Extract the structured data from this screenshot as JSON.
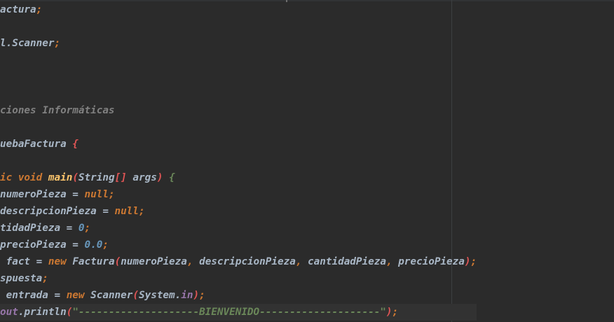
{
  "editor": {
    "lines": [
      {
        "segments": [
          {
            "t": "actura",
            "c": "plain"
          },
          {
            "t": ";",
            "c": "semi"
          }
        ]
      },
      {
        "segments": []
      },
      {
        "segments": [
          {
            "t": "l.Scanner",
            "c": "plain"
          },
          {
            "t": ";",
            "c": "semi"
          }
        ]
      },
      {
        "segments": []
      },
      {
        "segments": []
      },
      {
        "segments": []
      },
      {
        "segments": [
          {
            "t": "ciones Informáticas",
            "c": "cmt"
          }
        ]
      },
      {
        "segments": []
      },
      {
        "segments": [
          {
            "t": "uebaFactura ",
            "c": "plain"
          },
          {
            "t": "{",
            "c": "br-red"
          }
        ]
      },
      {
        "segments": []
      },
      {
        "segments": [
          {
            "t": "ic void ",
            "c": "kw"
          },
          {
            "t": "main",
            "c": "fn"
          },
          {
            "t": "(",
            "c": "br-red"
          },
          {
            "t": "String",
            "c": "plain"
          },
          {
            "t": "[]",
            "c": "br-red"
          },
          {
            "t": " args",
            "c": "plain"
          },
          {
            "t": ")",
            "c": "br-red"
          },
          {
            "t": " ",
            "c": "plain"
          },
          {
            "t": "{",
            "c": "br-green"
          }
        ]
      },
      {
        "segments": [
          {
            "t": "numeroPieza = ",
            "c": "plain"
          },
          {
            "t": "null",
            "c": "kw"
          },
          {
            "t": ";",
            "c": "semi"
          }
        ]
      },
      {
        "segments": [
          {
            "t": "descripcionPieza = ",
            "c": "plain"
          },
          {
            "t": "null",
            "c": "kw"
          },
          {
            "t": ";",
            "c": "semi"
          }
        ]
      },
      {
        "segments": [
          {
            "t": "tidadPieza = ",
            "c": "plain"
          },
          {
            "t": "0",
            "c": "num"
          },
          {
            "t": ";",
            "c": "semi"
          }
        ]
      },
      {
        "segments": [
          {
            "t": "precioPieza = ",
            "c": "plain"
          },
          {
            "t": "0.0",
            "c": "num"
          },
          {
            "t": ";",
            "c": "semi"
          }
        ]
      },
      {
        "segments": [
          {
            "t": " fact = ",
            "c": "plain"
          },
          {
            "t": "new ",
            "c": "kw"
          },
          {
            "t": "Factura",
            "c": "plain"
          },
          {
            "t": "(",
            "c": "br-red"
          },
          {
            "t": "numeroPieza",
            "c": "plain"
          },
          {
            "t": ", ",
            "c": "semi"
          },
          {
            "t": "descripcionPieza",
            "c": "plain"
          },
          {
            "t": ", ",
            "c": "semi"
          },
          {
            "t": "cantidadPieza",
            "c": "plain"
          },
          {
            "t": ", ",
            "c": "semi"
          },
          {
            "t": "precioPieza",
            "c": "plain"
          },
          {
            "t": ")",
            "c": "br-red"
          },
          {
            "t": ";",
            "c": "semi"
          }
        ]
      },
      {
        "segments": [
          {
            "t": "spuesta",
            "c": "plain"
          },
          {
            "t": ";",
            "c": "semi"
          }
        ]
      },
      {
        "segments": [
          {
            "t": " entrada = ",
            "c": "plain"
          },
          {
            "t": "new ",
            "c": "kw"
          },
          {
            "t": "Scanner",
            "c": "plain"
          },
          {
            "t": "(",
            "c": "br-red"
          },
          {
            "t": "System.",
            "c": "plain"
          },
          {
            "t": "in",
            "c": "fld"
          },
          {
            "t": ")",
            "c": "br-red"
          },
          {
            "t": ";",
            "c": "semi"
          }
        ]
      },
      {
        "segments": [
          {
            "t": "out",
            "c": "fld"
          },
          {
            "t": ".println",
            "c": "plain"
          },
          {
            "t": "(",
            "c": "br-red"
          },
          {
            "t": "\"--------------------BIENVENIDO--------------------\"",
            "c": "str"
          },
          {
            "t": ")",
            "c": "br-red"
          },
          {
            "t": ";",
            "c": "semi"
          }
        ],
        "current": true
      }
    ]
  }
}
